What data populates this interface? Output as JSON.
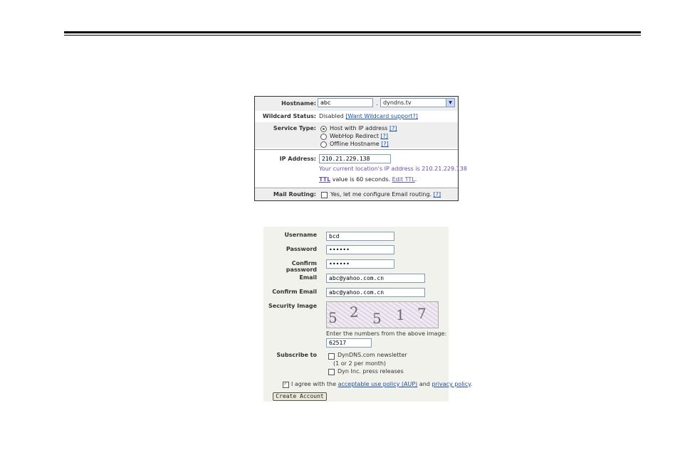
{
  "hostname_form": {
    "hostname_label": "Hostname:",
    "hostname_value": "abc",
    "dot": ".",
    "domain_value": "dyndns.tv",
    "wildcard_label": "Wildcard Status:",
    "wildcard_value": "Disabled",
    "wildcard_link": "[Want Wildcard support?]",
    "service_label": "Service Type:",
    "service_options": [
      {
        "label": "Host with IP address",
        "help": "[?]",
        "selected": true
      },
      {
        "label": "WebHop Redirect",
        "help": "[?]",
        "selected": false
      },
      {
        "label": "Offline Hostname",
        "help": "[?]",
        "selected": false
      }
    ],
    "ip_label": "IP Address:",
    "ip_value": "210.21.229.138",
    "ip_hint": "Your current location's IP address is 210.21.229.138",
    "ttl_link": "TTL",
    "ttl_text": "value is 60 seconds.",
    "ttl_edit": "Edit TTL",
    "ttl_end": ".",
    "mail_label": "Mail Routing:",
    "mail_text": "Yes, let me configure Email routing.",
    "mail_help": "[?]"
  },
  "account_form": {
    "username_label": "Username",
    "username_value": "bcd",
    "password_label": "Password",
    "password_value": "••••••",
    "confirm_password_label": "Confirm password",
    "confirm_password_value": "••••••",
    "email_label": "Email",
    "email_value": "abc@yahoo.com.cn",
    "confirm_email_label": "Confirm Email",
    "confirm_email_value": "abc@yahoo.com.cn",
    "security_label": "Security Image",
    "captcha_digits": [
      "5",
      "2",
      "5",
      "1",
      "7"
    ],
    "captcha_hint": "Enter the numbers from the above image:",
    "captcha_value": "62517",
    "subscribe_label": "Subscribe to",
    "subscribe_newsletter": "DynDNS.com newsletter",
    "subscribe_newsletter_note": "(1 or 2 per month)",
    "subscribe_press": "Dyn Inc. press releases",
    "agree_prefix": "I agree with the",
    "agree_aup": "acceptable use policy (AUP)",
    "agree_and": "and",
    "agree_privacy": "privacy policy",
    "agree_end": ".",
    "create_button": "Create Account"
  }
}
